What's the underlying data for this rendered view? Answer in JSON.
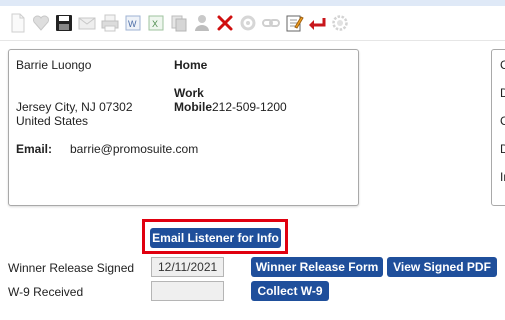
{
  "toolbar": {
    "icons": [
      "new-document-icon",
      "heart-icon",
      "save-icon",
      "email-icon",
      "print-icon",
      "word-export-icon",
      "excel-export-icon",
      "copy-icon",
      "user-icon",
      "delete-icon",
      "gear-disabled-icon",
      "link-icon",
      "edit-notes-icon",
      "return-icon",
      "settings-icon"
    ]
  },
  "contact": {
    "name": "Barrie Luongo",
    "city_state_zip": "Jersey City, NJ 07302",
    "country": "United States",
    "email_label": "Email:",
    "email": "barrie@promosuite.com",
    "home_label": "Home",
    "work_label": "Work",
    "mobile_label": "Mobile",
    "mobile": "212-509-1200"
  },
  "side_card": {
    "letters": [
      "C",
      "D",
      "C",
      "D",
      "In"
    ]
  },
  "actions": {
    "email_listener": "Email Listener for Info",
    "winner_release_signed_label": "Winner Release Signed",
    "winner_release_signed_date": "12/11/2021",
    "winner_release_form": "Winner Release Form",
    "view_signed_pdf": "View Signed PDF",
    "w9_label": "W-9 Received",
    "w9_value": "",
    "collect_w9": "Collect W-9"
  },
  "colors": {
    "button": "#1f4f9b",
    "highlight": "#e0000f"
  }
}
